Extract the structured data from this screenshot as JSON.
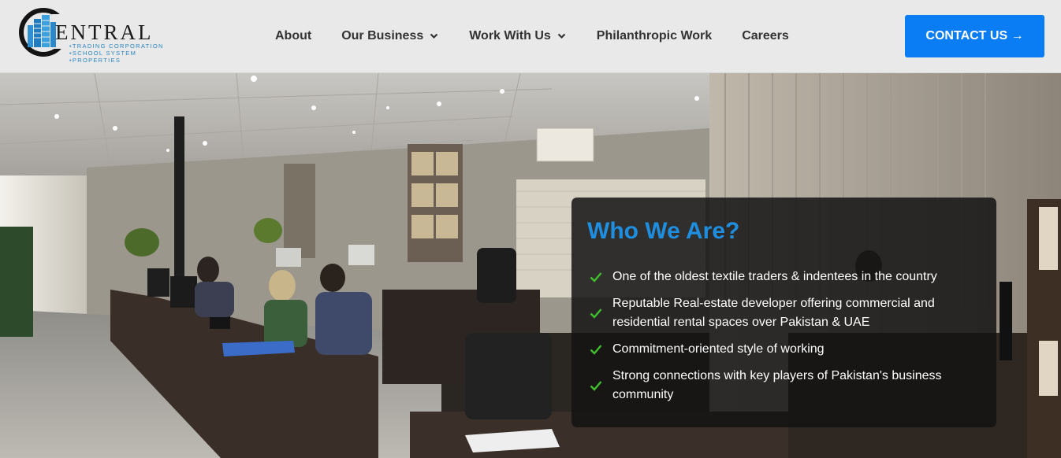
{
  "header": {
    "logo": {
      "word": "CENTRAL",
      "word_rest": "ENTRAL",
      "sub_lines": [
        "•TRADING CORPORATION",
        "•SCHOOL SYSTEM",
        "•PROPERTIES"
      ]
    },
    "nav": [
      {
        "label": "About",
        "has_dropdown": false
      },
      {
        "label": "Our Business",
        "has_dropdown": true
      },
      {
        "label": "Work With Us",
        "has_dropdown": true
      },
      {
        "label": "Philanthropic Work",
        "has_dropdown": false
      },
      {
        "label": "Careers",
        "has_dropdown": false
      }
    ],
    "contact_label": "CONTACT US →"
  },
  "hero": {
    "card_title": "Who We Are?",
    "points": [
      "One of the oldest textile traders & indentees in the country",
      "Reputable Real-estate developer offering commercial and residential rental spaces over Pakistan & UAE",
      "Commitment-oriented style of working",
      "Strong connections with key players of Pakistan's business community"
    ]
  },
  "colors": {
    "accent": "#0a7cf4",
    "title_blue": "#1e8fe0",
    "check_green": "#3fbf2e",
    "header_bg": "#e9e9e9"
  },
  "icons": {
    "logo": "building-circle-logo-icon",
    "dropdown": "chevron-down-icon",
    "check": "check-icon"
  }
}
